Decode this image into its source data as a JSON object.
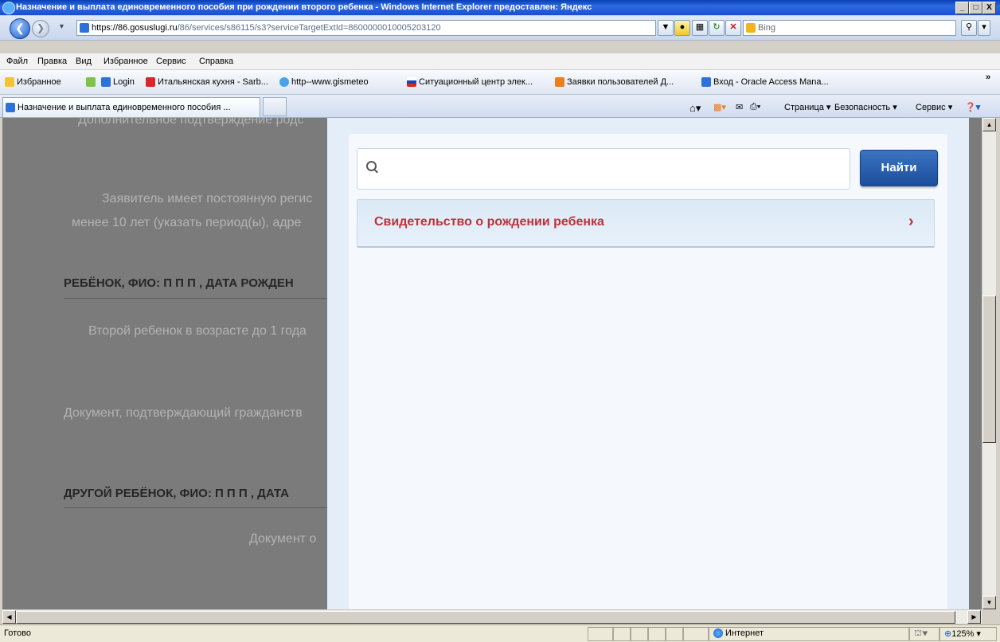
{
  "window": {
    "title": "Назначение и выплата единовременного пособия при рождении второго ребенка - Windows Internet Explorer предоставлен: Яндекс",
    "controls": [
      "_",
      "□",
      "X"
    ]
  },
  "address": {
    "url_host": "https://86.gosuslugi.ru",
    "url_path": "/86/services/s86115/s3?serviceTargetExtId=8600000010005203120",
    "search_placeholder": "Bing"
  },
  "menu": [
    "Файл",
    "Правка",
    "Вид",
    "Избранное",
    "Сервис",
    "Справка"
  ],
  "favorites": {
    "label": "Избранное",
    "items": [
      "Login",
      "Итальянская кухня - Sarb...",
      "http--www.gismeteo",
      "Ситуационный центр элек...",
      "Заявки пользователей Д...",
      "Вход - Oracle Access Mana..."
    ],
    "overflow": "»"
  },
  "tab": {
    "title": "Назначение и выплата единовременного пособия ..."
  },
  "command_bar": [
    "Страница ▾",
    "Безопасность ▾",
    "Сервис ▾"
  ],
  "background_page": {
    "line1": "Дополнительное подтверждение родс",
    "line2": "Заявитель имеет постоянную регис",
    "line3": "менее 10 лет (указать период(ы), адре",
    "heading1": "РЕБЁНОК, ФИО: П П П , ДАТА РОЖДЕН",
    "line4": "Второй ребенок в возрасте до 1 года",
    "line5": "Документ, подтверждающий гражданств",
    "heading2": "ДРУГОЙ РЕБЁНОК, ФИО: П П П , ДАТА",
    "line6": "Документ о"
  },
  "modal": {
    "search_value": "",
    "find_button": "Найти",
    "result": "Свидетельство о рождении ребенка"
  },
  "status": {
    "left": "Готово",
    "zone": "Интернет",
    "zoom": "125%"
  }
}
